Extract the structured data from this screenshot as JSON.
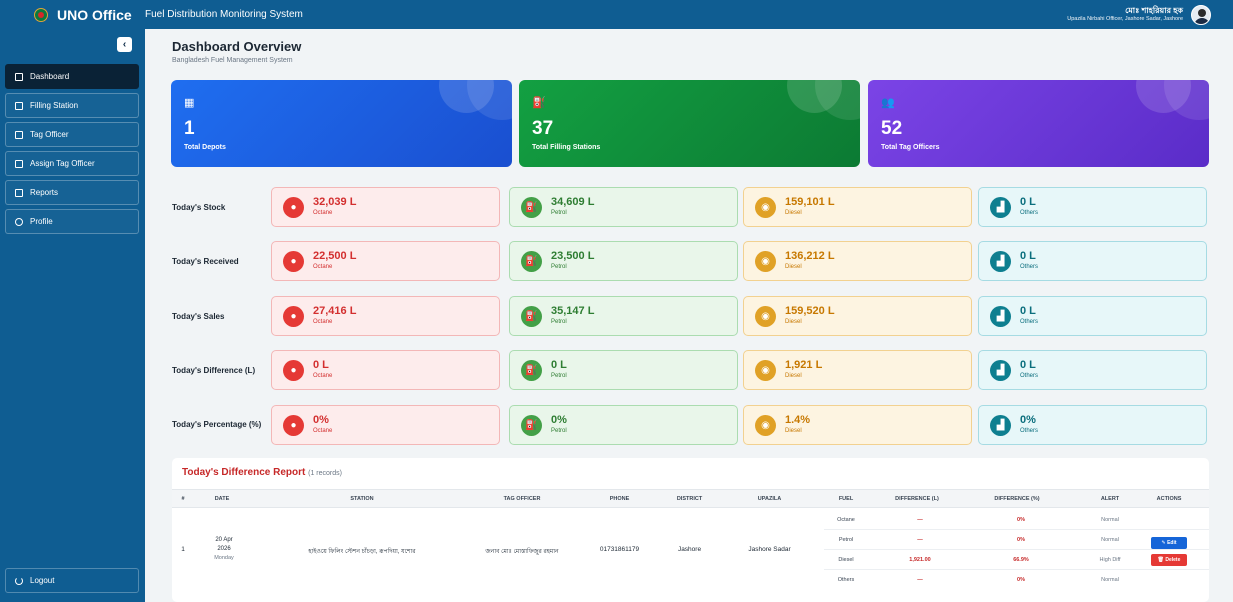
{
  "topbar": {
    "brand": "UNO Office",
    "system_name": "Fuel Distribution Monitoring System",
    "user_name": "মোঃ শাহরিয়ার হক",
    "user_role": "Upazila Nirbahi Officer, Jashore Sadar, Jashore"
  },
  "sidebar": {
    "items": [
      {
        "label": "Dashboard",
        "icon": "grid-icon",
        "active": true
      },
      {
        "label": "Filling Station",
        "icon": "station-icon"
      },
      {
        "label": "Tag Officer",
        "icon": "id-card-icon"
      },
      {
        "label": "Assign Tag Officer",
        "icon": "checkbox-icon"
      },
      {
        "label": "Reports",
        "icon": "document-icon"
      },
      {
        "label": "Profile",
        "icon": "user-icon"
      }
    ],
    "logout": "Logout"
  },
  "page": {
    "title": "Dashboard Overview",
    "subtitle": "Bangladesh Fuel Management System"
  },
  "stats": [
    {
      "value": "1",
      "label": "Total Depots",
      "icon": "building-icon",
      "color": "#1d5fe6"
    },
    {
      "value": "37",
      "label": "Total Filling Stations",
      "icon": "fuel-pump-icon",
      "color": "#0f8a3c"
    },
    {
      "value": "52",
      "label": "Total Tag Officers",
      "icon": "users-icon",
      "color": "#6a35d6"
    }
  ],
  "rows": [
    {
      "label": "Today's Stock",
      "values": [
        "32,039 L",
        "34,609 L",
        "159,101 L",
        "0 L"
      ]
    },
    {
      "label": "Today's Received",
      "values": [
        "22,500 L",
        "23,500 L",
        "136,212 L",
        "0 L"
      ]
    },
    {
      "label": "Today's Sales",
      "values": [
        "27,416 L",
        "35,147 L",
        "159,520 L",
        "0 L"
      ]
    },
    {
      "label": "Today's Difference (L)",
      "values": [
        "0 L",
        "0 L",
        "1,921 L",
        "0 L"
      ]
    },
    {
      "label": "Today's Percentage (%)",
      "values": [
        "0%",
        "0%",
        "1.4%",
        "0%"
      ]
    }
  ],
  "fuel_types": [
    "Octane",
    "Petrol",
    "Diesel",
    "Others"
  ],
  "report": {
    "title": "Today's Difference Report",
    "count": "(1 records)",
    "columns": [
      "#",
      "DATE",
      "STATION",
      "TAG OFFICER",
      "PHONE",
      "DISTRICT",
      "UPAZILA",
      "FUEL",
      "DIFFERENCE (L)",
      "DIFFERENCE (%)",
      "ALERT",
      "ACTIONS"
    ],
    "row": {
      "index": "1",
      "date_day": "20 Apr",
      "date_year": "2026",
      "date_weekday": "Monday",
      "station": "হাইওয়ে ফিলিং স্টেশন চাঁচড়া, রূপদিয়া, যশোর",
      "tag_officer": "জনাব মোঃ মোস্তাফিজুর রহমান",
      "phone": "01731861179",
      "district": "Jashore",
      "upazila": "Jashore Sadar",
      "fuels": [
        {
          "fuel": "Octane",
          "diff_l": "—",
          "diff_pct": "0%",
          "alert": "Normal"
        },
        {
          "fuel": "Petrol",
          "diff_l": "—",
          "diff_pct": "0%",
          "alert": "Normal"
        },
        {
          "fuel": "Diesel",
          "diff_l": "1,921.00",
          "diff_pct": "66.9%",
          "alert": "High Diff"
        },
        {
          "fuel": "Others",
          "diff_l": "—",
          "diff_pct": "0%",
          "alert": "Normal"
        }
      ],
      "edit_label": "✎ Edit",
      "delete_label": "🗑 Delete"
    }
  }
}
